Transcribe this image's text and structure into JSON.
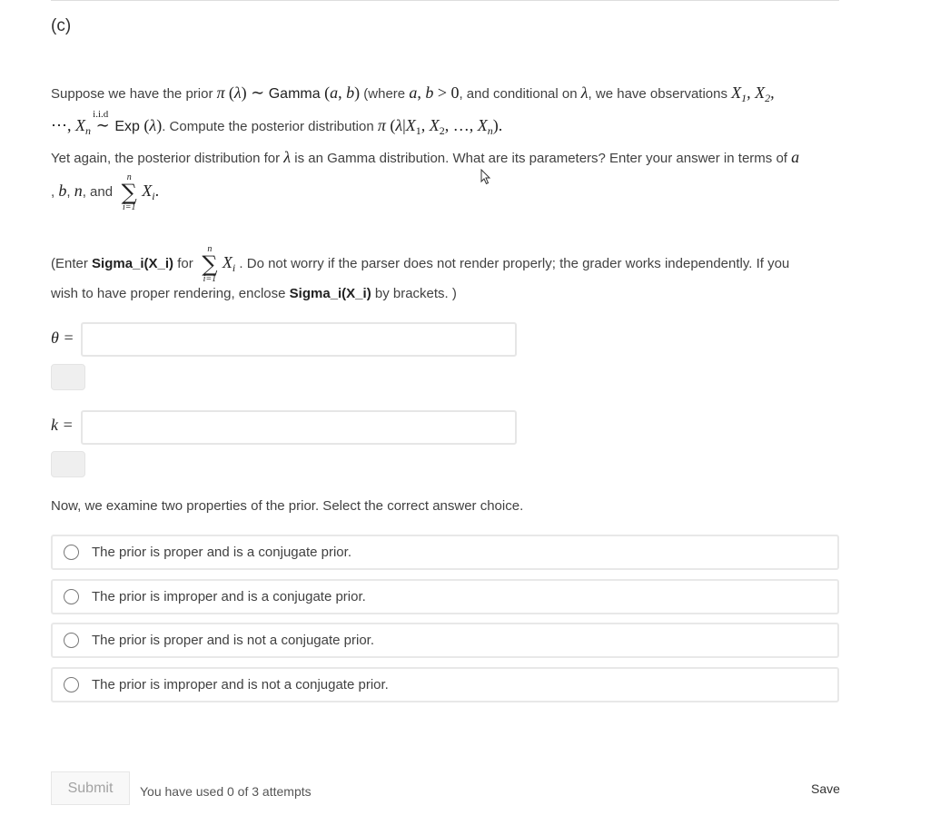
{
  "part_label": "(c)",
  "intro": {
    "t1": "Suppose we have the prior ",
    "pi": "π",
    "lambda": "(λ)",
    "sim": " ∼ ",
    "gamma": "Gamma",
    "ab": " (a, b)",
    "t2": " (where ",
    "cond": "a, b > 0",
    "t3": ", and conditional on ",
    "lam": "λ",
    "t4": ", we have observations ",
    "obs": "X",
    "line2_dots": "⋯, X",
    "iid": "i.i.d",
    "tilde": "∼",
    "exp": "Exp",
    "exp_arg": " (λ)",
    "t5": ". Compute the posterior distribution ",
    "posterior": "π (λ|X",
    "posterior_rest": ", X",
    "posterior_end": ", …, X"
  },
  "para2": {
    "t1": "Yet again, the posterior distribution for ",
    "lam": "λ",
    "t2": " is an Gamma distribution. What are its parameters? Enter your answer in terms of ",
    "a": "a",
    "line2_a": ", ",
    "b": "b",
    "comma": ", ",
    "n": "n",
    "and": ", and ",
    "sum_top": "n",
    "sum_sig": "∑",
    "sum_bot": "i=1",
    "xi": "X",
    "xi_sub": "i",
    "end": "."
  },
  "para3": {
    "t1": "(Enter ",
    "bold1": "Sigma_i(X_i)",
    "t2": " for ",
    "sum_top": "n",
    "sum_sig": "∑",
    "sum_bot": "i=1",
    "xi": "X",
    "xi_sub": "i",
    "t3": " . Do not worry if the parser does not render properly; the grader works independently. If you",
    "t4": "wish to have proper rendering, enclose ",
    "bold2": "Sigma_i(X_i)",
    "t5": " by brackets. )"
  },
  "inputs": [
    {
      "label": "θ =",
      "value": "",
      "placeholder": ""
    },
    {
      "label": "k =",
      "value": "",
      "placeholder": ""
    }
  ],
  "question": "Now, we examine two properties of the prior. Select the correct answer choice.",
  "choices": [
    {
      "label": "The prior is proper and is a conjugate prior.",
      "selected": false
    },
    {
      "label": "The prior is improper and is a conjugate prior.",
      "selected": false
    },
    {
      "label": "The prior is proper and is not a conjugate prior.",
      "selected": false
    },
    {
      "label": "The prior is improper and is not a conjugate prior.",
      "selected": false
    }
  ],
  "footer": {
    "submit_label": "Submit",
    "attempts_text": "You have used 0 of 3 attempts",
    "save_label": "Save"
  },
  "icons": {
    "cursor": "mouse-pointer-icon",
    "radio": "radio-circle-icon"
  }
}
